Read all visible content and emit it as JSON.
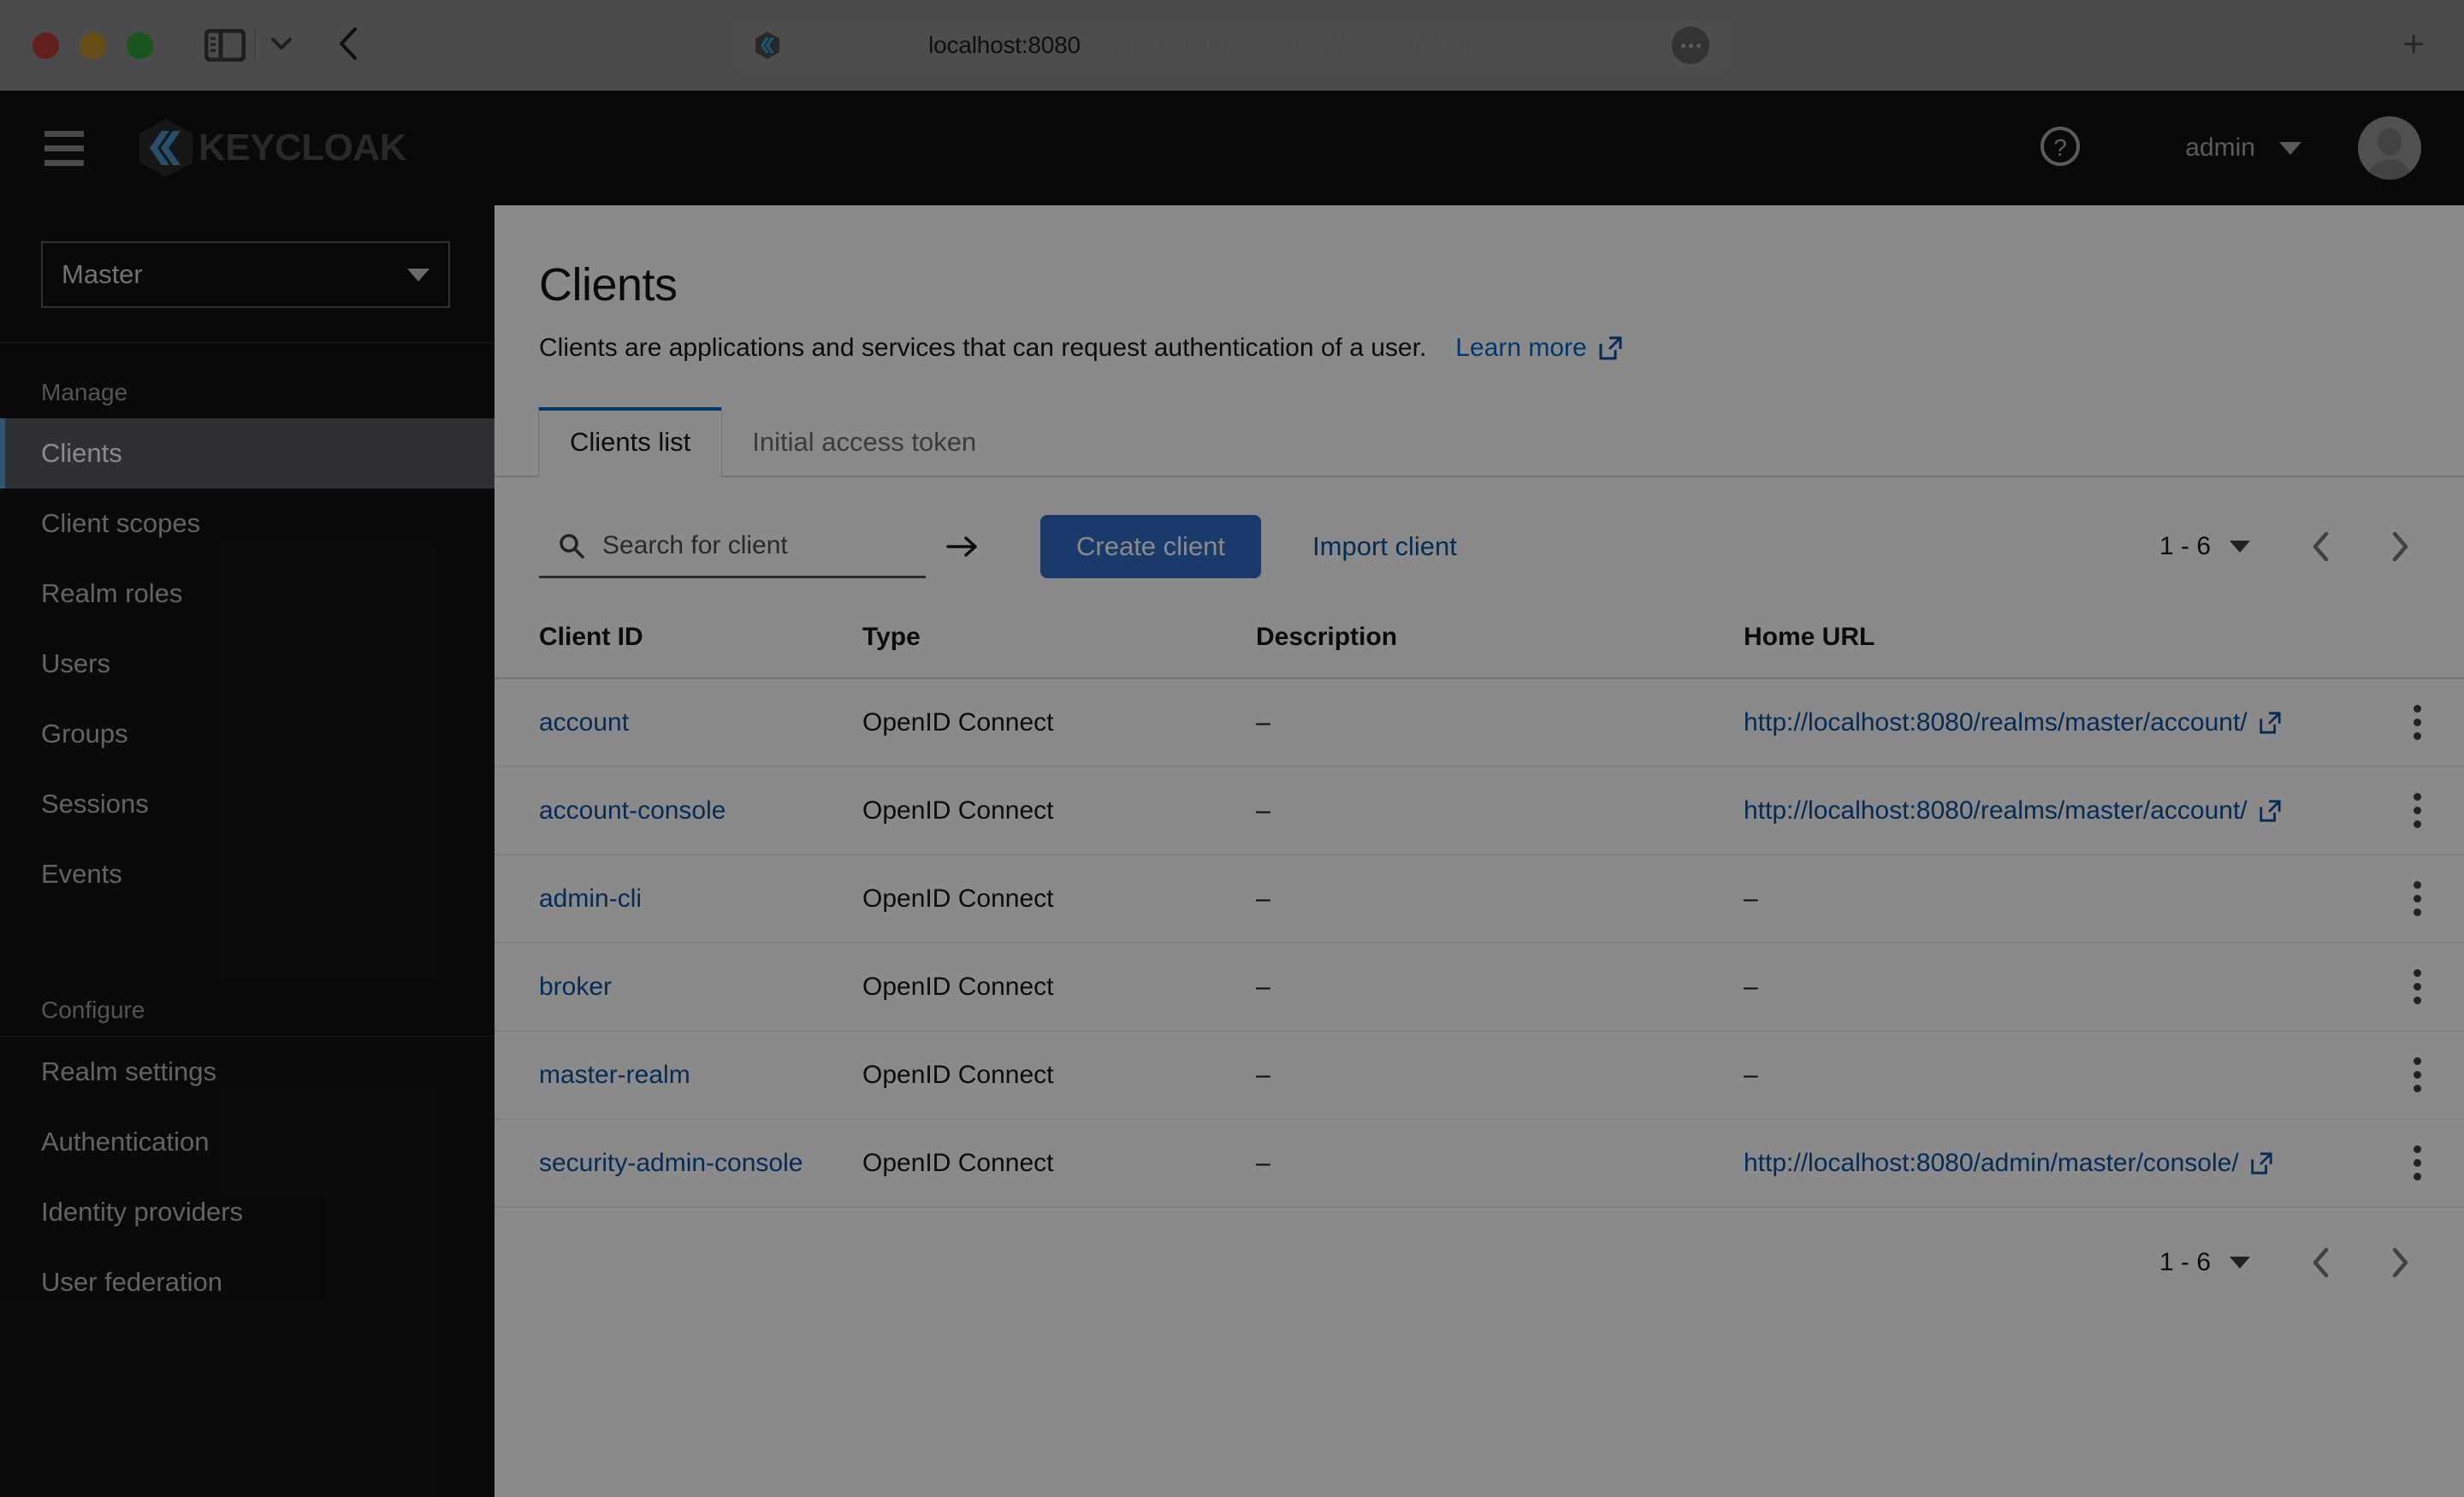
{
  "browser": {
    "url_host": "localhost:8080",
    "url_path": "/admin/master/console/#/master/clients",
    "new_tab_label": "+",
    "icons": {
      "sidebar_toggle": "sidebar-toggle-icon",
      "chevron_down": "chevron-down-icon",
      "back": "back-arrow-icon",
      "more": "more-options-icon",
      "favicon": "keycloak-favicon"
    }
  },
  "masthead": {
    "brand": "KEYCLOAK",
    "hamburger_label": "global-navigation-toggle",
    "help_label": "help-icon",
    "user": "admin",
    "avatar_label": "user-avatar"
  },
  "sidebar": {
    "realm": {
      "selected": "Master"
    },
    "groups": [
      {
        "title": "Manage",
        "items": [
          {
            "label": "Clients",
            "active": true
          },
          {
            "label": "Client scopes",
            "active": false
          },
          {
            "label": "Realm roles",
            "active": false
          },
          {
            "label": "Users",
            "active": false
          },
          {
            "label": "Groups",
            "active": false
          },
          {
            "label": "Sessions",
            "active": false
          },
          {
            "label": "Events",
            "active": false
          }
        ]
      },
      {
        "title": "Configure",
        "items": [
          {
            "label": "Realm settings",
            "active": false
          },
          {
            "label": "Authentication",
            "active": false
          },
          {
            "label": "Identity providers",
            "active": false
          },
          {
            "label": "User federation",
            "active": false
          }
        ]
      }
    ]
  },
  "main": {
    "title": "Clients",
    "subtitle": "Clients are applications and services that can request authentication of a user.",
    "learn_more": "Learn more",
    "tabs": [
      {
        "label": "Clients list",
        "active": true
      },
      {
        "label": "Initial access token",
        "active": false
      }
    ],
    "toolbar": {
      "search_placeholder": "Search for client",
      "search_value": "",
      "create_label": "Create client",
      "import_label": "Import client"
    },
    "pagination": {
      "range": "1 - 6",
      "prev_label": "previous-page",
      "next_label": "next-page"
    },
    "table": {
      "columns": [
        "Client ID",
        "Type",
        "Description",
        "Home URL"
      ],
      "rows": [
        {
          "client_id": "account",
          "type": "OpenID Connect",
          "description": "–",
          "home_url": "http://localhost:8080/realms/master/account/",
          "has_url": true
        },
        {
          "client_id": "account-console",
          "type": "OpenID Connect",
          "description": "–",
          "home_url": "http://localhost:8080/realms/master/account/",
          "has_url": true
        },
        {
          "client_id": "admin-cli",
          "type": "OpenID Connect",
          "description": "–",
          "home_url": "–",
          "has_url": false
        },
        {
          "client_id": "broker",
          "type": "OpenID Connect",
          "description": "–",
          "home_url": "–",
          "has_url": false
        },
        {
          "client_id": "master-realm",
          "type": "OpenID Connect",
          "description": "–",
          "home_url": "–",
          "has_url": false
        },
        {
          "client_id": "security-admin-console",
          "type": "OpenID Connect",
          "description": "–",
          "home_url": "http://localhost:8080/admin/master/console/",
          "has_url": true
        }
      ]
    }
  },
  "colors": {
    "accent_blue": "#06c",
    "button_blue": "#2f6cc4",
    "link_blue": "#0a50a1",
    "masthead_black": "#111111",
    "sidebar_black": "#141414",
    "nav_active": "#555a60",
    "nav_active_border": "#5a9fd4"
  }
}
